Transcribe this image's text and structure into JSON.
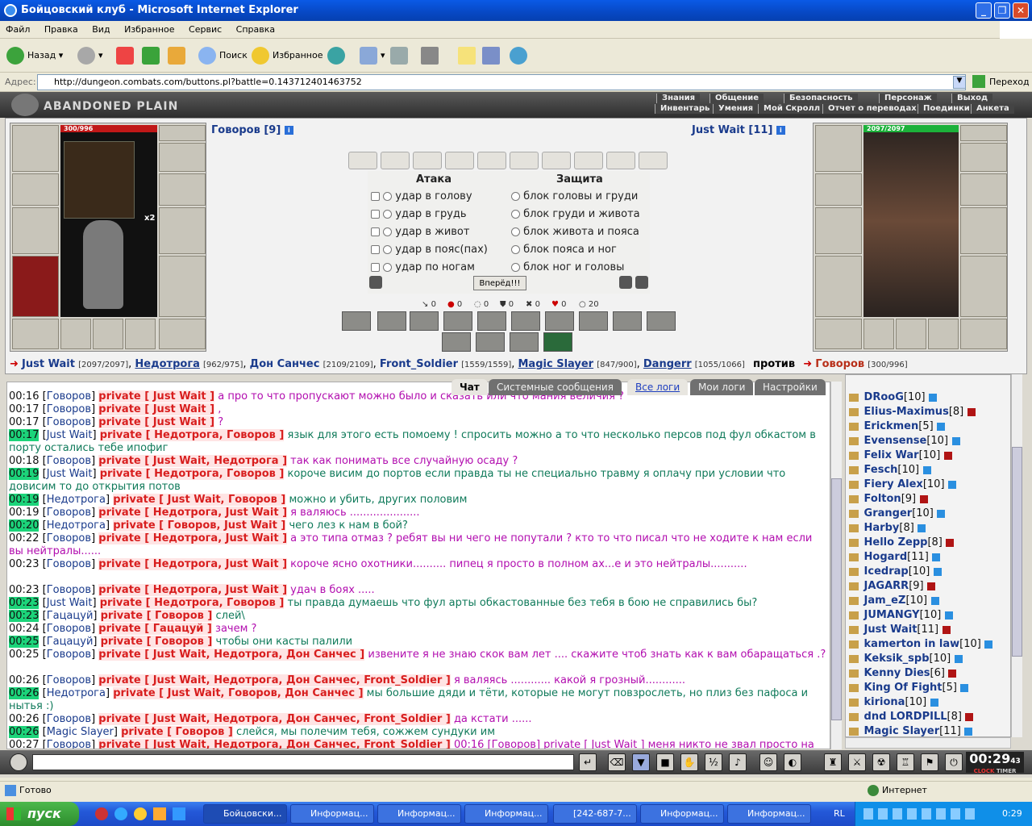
{
  "window": {
    "title": "Бойцовский клуб - Microsoft Internet Explorer"
  },
  "menu": [
    "Файл",
    "Правка",
    "Вид",
    "Избранное",
    "Сервис",
    "Справка"
  ],
  "toolbar": {
    "back": "Назад",
    "search": "Поиск",
    "favorites": "Избранное"
  },
  "address": {
    "label": "Адрес:",
    "url": "http://dungeon.combats.com/buttons.pl?battle=0.143712401463752",
    "go": "Переход"
  },
  "game": {
    "location": "ABANDONED PLAIN",
    "nav_top": [
      "Знания",
      "Общение",
      "Безопасность",
      "Персонаж",
      "Выход"
    ],
    "nav_bottom": [
      "Инвентарь",
      "Умения",
      "Мой Скролл",
      "Отчет о переводах",
      "Поединки",
      "Анкета"
    ]
  },
  "player": {
    "name": "Говоров [9]",
    "hp": "300/996",
    "stack": "x2"
  },
  "enemy": {
    "name": "Just Wait [11]",
    "hp": "2097/2097"
  },
  "battle": {
    "attack_title": "Атака",
    "defense_title": "Защита",
    "attacks": [
      "удар в голову",
      "удар в грудь",
      "удар в живот",
      "удар в пояс(пах)",
      "удар по ногам"
    ],
    "blocks": [
      "блок головы и груди",
      "блок груди и живота",
      "блок живота и пояса",
      "блок пояса и ног",
      "блок ног и головы"
    ],
    "go_button": "Вперёд!!!",
    "stats": [
      "0",
      "0",
      "0",
      "0",
      "0",
      "0",
      "20"
    ]
  },
  "fight": {
    "team1": [
      {
        "name": "Just Wait",
        "hp": "[2097/2097]"
      },
      {
        "name": "Недотрога",
        "hp": "[962/975]"
      },
      {
        "name": "Дон Санчес",
        "hp": "[2109/2109]"
      },
      {
        "name": "Front_Soldier",
        "hp": "[1559/1559]"
      },
      {
        "name": "Magic Slayer",
        "hp": "[847/900]"
      },
      {
        "name": "Dangerr",
        "hp": "[1055/1066]"
      }
    ],
    "vs": "против",
    "team2": [
      {
        "name": "Говоров",
        "hp": "[300/996]"
      }
    ]
  },
  "tabs": [
    "Чат",
    "Системные сообщения",
    "Все логи",
    "Мои логи",
    "Настройки"
  ],
  "chat": [
    {
      "time": "00:16",
      "who": "Говоров",
      "priv": "private [ Just Wait ]",
      "text": "а про то что пропускают можно было и сказать или что мания величия ?",
      "c": "txt"
    },
    {
      "time": "00:17",
      "who": "Говоров",
      "priv": "private [ Just Wait ]",
      "text": ",",
      "c": "txt"
    },
    {
      "time": "00:17",
      "who": "Говоров",
      "priv": "private [ Just Wait ]",
      "text": "?",
      "c": "txt"
    },
    {
      "time": "00:17",
      "hl": true,
      "who": "Just Wait",
      "priv": "private [ Недотрога, Говоров ]",
      "text": "язык для этого есть помоему ! спросить можно а то что несколько персов под фул обкастом в порту остались тебе ипофиг",
      "c": "txtg"
    },
    {
      "time": "00:18",
      "who": "Говоров",
      "priv": "private [ Just Wait, Недотрога ]",
      "text": "так как понимать все случайную осаду ?",
      "c": "txt"
    },
    {
      "time": "00:19",
      "hl": true,
      "who": "Just Wait",
      "priv": "private [ Недотрога, Говоров ]",
      "text": "короче висим до портов если правда ты не специально травму я оплачу при условии что довисим то до открытия потов",
      "c": "txtg"
    },
    {
      "time": "00:19",
      "hl": true,
      "who": "Недотрога",
      "priv": "private [ Just Wait, Говоров ]",
      "text": "можно и убить, других половим",
      "c": "txtg"
    },
    {
      "time": "00:19",
      "who": "Говоров",
      "priv": "private [ Недотрога, Just Wait ]",
      "text": "я валяюсь .....................",
      "c": "txt"
    },
    {
      "time": "00:20",
      "hl": true,
      "who": "Недотрога",
      "priv": "private [ Говоров, Just Wait ]",
      "text": "чего лез к нам в бой?",
      "c": "txtg"
    },
    {
      "time": "00:22",
      "who": "Говоров",
      "priv": "private [ Недотрога, Just Wait ]",
      "text": "а это типа отмаз ? ребят вы ни чего не попутали ? кто то что писал что не ходите к нам если вы нейтралы......",
      "c": "txt"
    },
    {
      "time": "00:23",
      "who": "Говоров",
      "priv": "private [ Недотрога, Just Wait ]",
      "text": "короче ясно охотники.......... пипец я просто в полном ах...е и это нейтралы...........",
      "c": "txt"
    },
    {
      "time": "00:23",
      "who": "Говоров",
      "priv": "private [ Недотрога, Just Wait ]",
      "text": "удач в боях .....",
      "c": "txt"
    },
    {
      "time": "00:23",
      "hl": true,
      "who": "Just Wait",
      "priv": "private [ Недотрога, Говоров ]",
      "text": "ты правда думаешь что фул арты обкастованные без тебя в бою не справились бы?",
      "c": "txtg"
    },
    {
      "time": "00:23",
      "hl": true,
      "who": "Гацацуй",
      "priv": "private [ Говоров ]",
      "text": "слей\\",
      "c": "txtg"
    },
    {
      "time": "00:24",
      "who": "Говоров",
      "priv": "private [ Гацацуй ]",
      "text": "зачем ?",
      "c": "txt"
    },
    {
      "time": "00:25",
      "hl": true,
      "who": "Гацацуй",
      "priv": "private [ Говоров ]",
      "text": "чтобы они касты палили",
      "c": "txtg"
    },
    {
      "time": "00:25",
      "who": "Говоров",
      "priv": "private [ Just Wait, Недотрога, Дон Санчес ]",
      "text": "извените я не знаю скок вам лет .... скажите чтоб знать как к вам обаращаться .?",
      "c": "txt"
    },
    {
      "time": "00:26",
      "who": "Говоров",
      "priv": "private [ Just Wait, Недотрога, Дон Санчес, Front_Soldier ]",
      "text": "я валяясь ............ какой я грозный............",
      "c": "txt"
    },
    {
      "time": "00:26",
      "hl": true,
      "who": "Недотрога",
      "priv": "private [ Just Wait, Говоров, Дон Санчес ]",
      "text": "мы большие дяди и тёти, которые не могут повзрослеть, но плиз без пафоса и нытья :)",
      "c": "txtg"
    },
    {
      "time": "00:26",
      "who": "Говоров",
      "priv": "private [ Just Wait, Недотрога, Дон Санчес, Front_Soldier ]",
      "text": "да кстати ......",
      "c": "txt"
    },
    {
      "time": "00:26",
      "hl": true,
      "who": "Magic Slayer",
      "priv": "private [ Говоров ]",
      "text": "слейся, мы полечим тебя, сожжем сундуки им",
      "c": "txtg"
    },
    {
      "time": "00:27",
      "who": "Говоров",
      "priv": "private [ Just Wait, Недотрога, Дон Санчес, Front_Soldier ]",
      "text": "00:16 [Говоров] private [ Just Wait ] меня никто не звал просто на меня он нападал ....... аот смотрю его мокрят решил заскочить ....",
      "c": "txt"
    }
  ],
  "online": [
    {
      "name": "DRooG",
      "lvl": "[10]"
    },
    {
      "name": "Elius-Maximus",
      "lvl": "[8]"
    },
    {
      "name": "Erickmen",
      "lvl": "[5]"
    },
    {
      "name": "Evensense",
      "lvl": "[10]"
    },
    {
      "name": "Felix War",
      "lvl": "[10]"
    },
    {
      "name": "Fesch",
      "lvl": "[10]"
    },
    {
      "name": "Fiery Alex",
      "lvl": "[10]"
    },
    {
      "name": "Folton",
      "lvl": "[9]"
    },
    {
      "name": "Granger",
      "lvl": "[10]"
    },
    {
      "name": "Harby",
      "lvl": "[8]"
    },
    {
      "name": "Hello Zepp",
      "lvl": "[8]"
    },
    {
      "name": "Hogard",
      "lvl": "[11]"
    },
    {
      "name": "Icedrap",
      "lvl": "[10]"
    },
    {
      "name": "JAGARR",
      "lvl": "[9]"
    },
    {
      "name": "Jam_eZ",
      "lvl": "[10]"
    },
    {
      "name": "JUMANGY",
      "lvl": "[10]"
    },
    {
      "name": "Just Wait",
      "lvl": "[11]"
    },
    {
      "name": "kamerton in law",
      "lvl": "[10]"
    },
    {
      "name": "Keksik_spb",
      "lvl": "[10]"
    },
    {
      "name": "Kenny Dies",
      "lvl": "[6]"
    },
    {
      "name": "King Of Fight",
      "lvl": "[5]"
    },
    {
      "name": "kiriona",
      "lvl": "[10]"
    },
    {
      "name": "dnd LORDPILL",
      "lvl": "[8]"
    },
    {
      "name": "Magic Slayer",
      "lvl": "[11]"
    }
  ],
  "clock": {
    "time": "00:29",
    "sub": "43",
    "label1": "CLOCK",
    "label2": "TIMER"
  },
  "status": {
    "text": "Готово",
    "zone": "Интернет"
  },
  "taskbar": {
    "start": "пуск",
    "tasks": [
      "Бойцовски...",
      "Информац...",
      "Информац...",
      "Информац...",
      "[242-687-7...",
      "Информац...",
      "Информац..."
    ],
    "lang": "RL",
    "time": "0:29"
  }
}
